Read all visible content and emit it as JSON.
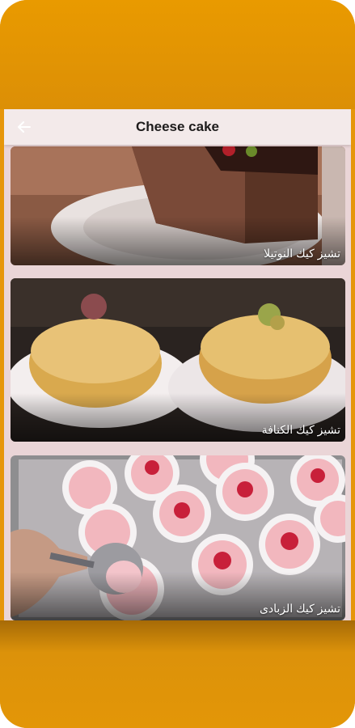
{
  "appbar": {
    "title": "Cheese cake",
    "back_icon": "arrow-left-icon"
  },
  "recipes": [
    {
      "name": "تشيز كيك النوتيلا"
    },
    {
      "name": "تشيز كيك الكنافة"
    },
    {
      "name": "تشيز كيك الزبادى"
    }
  ],
  "colors": {
    "frame_orange": "#e6960a",
    "appbar_bg": "#f3eaea",
    "title_text": "#1d1b1b",
    "screen_bg": "#ead5d7"
  }
}
